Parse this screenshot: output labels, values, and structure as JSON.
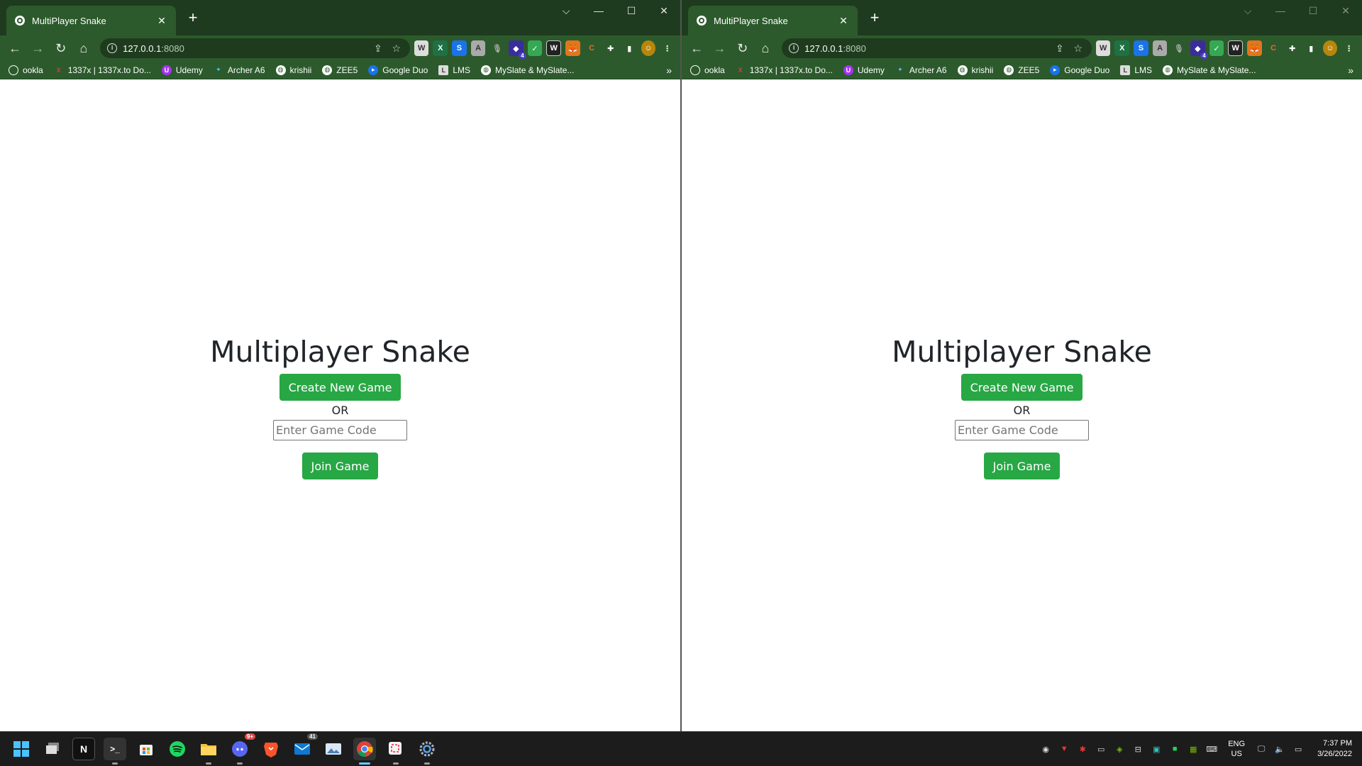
{
  "windows": [
    {
      "tab_title": "MultiPlayer Snake",
      "url_host": "127.0.0.1",
      "url_port": ":8080",
      "page": {
        "heading": "Multiplayer Snake",
        "create_label": "Create New Game",
        "or_text": "OR",
        "code_placeholder": "Enter Game Code",
        "join_label": "Join Game"
      }
    },
    {
      "tab_title": "MultiPlayer Snake",
      "url_host": "127.0.0.1",
      "url_port": ":8080",
      "page": {
        "heading": "Multiplayer Snake",
        "create_label": "Create New Game",
        "or_text": "OR",
        "code_placeholder": "Enter Game Code",
        "join_label": "Join Game"
      }
    }
  ],
  "bookmarks": [
    "ookla",
    "1337x | 1337x.to Do...",
    "Udemy",
    "Archer A6",
    "krishii",
    "ZEE5",
    "Google Duo",
    "LMS",
    "MySlate & MySlate..."
  ],
  "extensions_badge": "4",
  "taskbar": {
    "icons": [
      "windows-start-icon",
      "task-view-icon",
      "notion-icon",
      "terminal-icon",
      "microsoft-store-icon",
      "spotify-icon",
      "file-explorer-icon",
      "discord-icon",
      "brave-icon",
      "mail-icon",
      "photos-icon",
      "chrome-icon",
      "snipping-tool-icon",
      "settings-icon"
    ],
    "discord_badge": "9+",
    "mail_badge": "41",
    "lang_line1": "ENG",
    "lang_line2": "US",
    "time": "7:37 PM",
    "date": "3/26/2022"
  },
  "colors": {
    "chrome_frame": "#1f3b1f",
    "chrome_toolbar": "#2c5a2c",
    "button_green": "#28a745",
    "heading_text": "#212529"
  }
}
